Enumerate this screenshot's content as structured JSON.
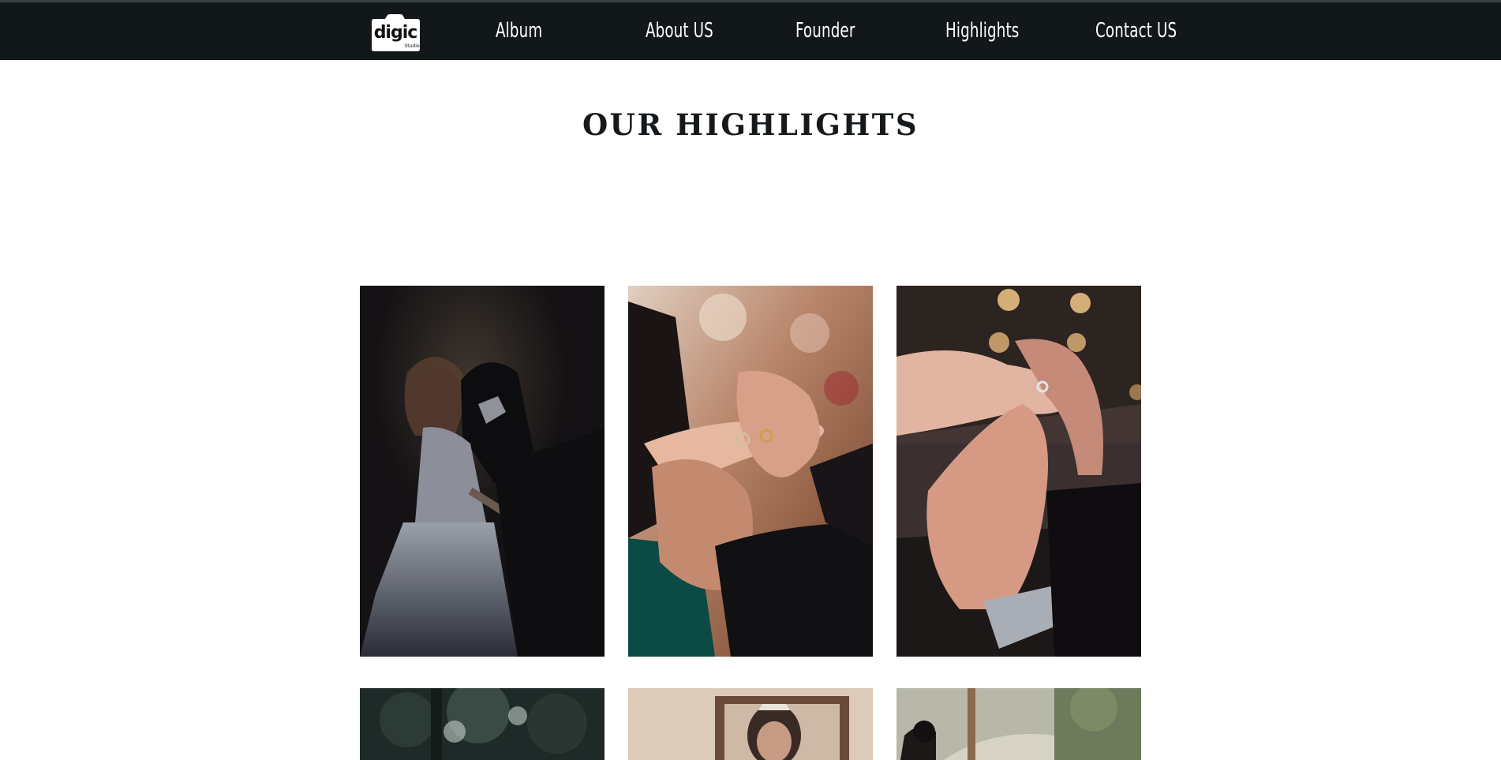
{
  "nav": {
    "logo_text": "digic",
    "logo_subtext": "Studio",
    "items": [
      {
        "label": "Album"
      },
      {
        "label": "About US"
      },
      {
        "label": "Founder"
      },
      {
        "label": "Highlights"
      },
      {
        "label": "Contact US"
      }
    ]
  },
  "section": {
    "title": "OUR HIGHLIGHTS"
  },
  "colors": {
    "navbar_bg": "#121719",
    "nav_text": "#ffffff",
    "title_text": "#15191b",
    "page_bg": "#ffffff"
  },
  "gallery": [
    {
      "name": "couple-foreheads-photo"
    },
    {
      "name": "ring-exchange-photo"
    },
    {
      "name": "hands-ring-photo"
    },
    {
      "name": "trees-photo"
    },
    {
      "name": "bride-mirror-photo"
    },
    {
      "name": "outdoor-path-photo"
    }
  ]
}
